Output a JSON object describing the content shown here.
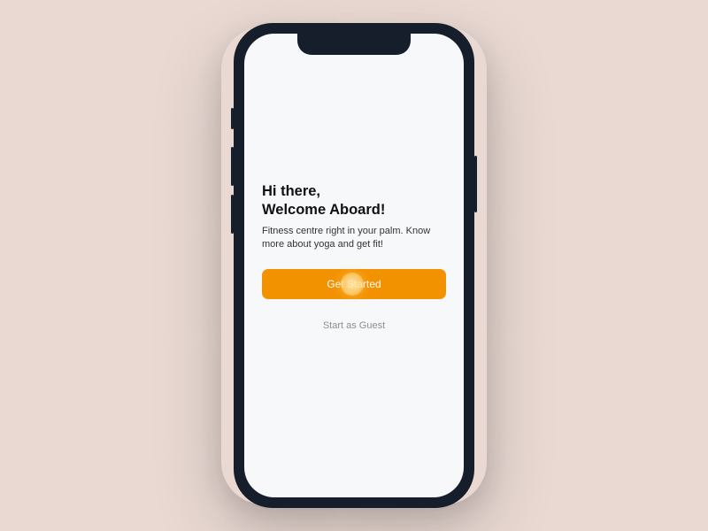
{
  "welcome": {
    "heading_line1": "Hi there,",
    "heading_line2": "Welcome Aboard!",
    "subtext": "Fitness centre right in your palm. Know more about yoga and get fit!",
    "primary_button": "Get Started",
    "guest_link": "Start as Guest"
  }
}
